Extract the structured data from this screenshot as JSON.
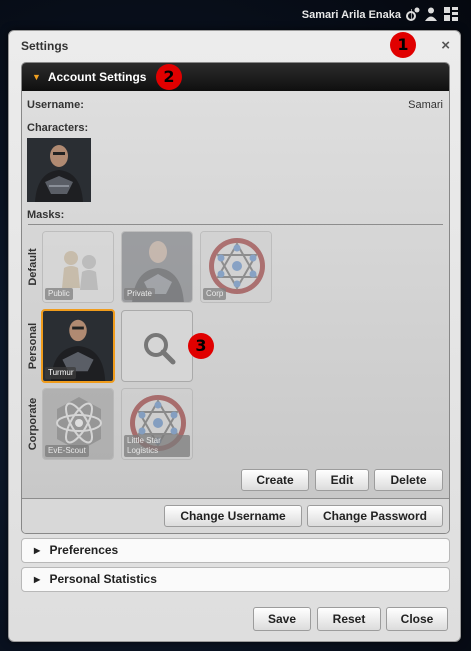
{
  "topbar": {
    "user_name": "Samari Arila Enaka",
    "separator": "|",
    "icons": [
      "settings-icon",
      "user-icon",
      "grid-icon"
    ]
  },
  "window": {
    "title": "Settings",
    "close_label": "×"
  },
  "callouts": [
    "1",
    "2",
    "3"
  ],
  "account_settings": {
    "header": "Account Settings",
    "username_label": "Username:",
    "username_value": "Samari",
    "characters_label": "Characters:",
    "masks_label": "Masks:",
    "groups": {
      "default": {
        "label": "Default",
        "masks": [
          "Public",
          "Private",
          "Corp"
        ]
      },
      "personal": {
        "label": "Personal",
        "masks": [
          "Turmur"
        ],
        "search_icon": "search-icon"
      },
      "corporate": {
        "label": "Corporate",
        "masks": [
          "EvE-Scout",
          "Little Star Logistics"
        ]
      }
    },
    "buttons": {
      "create": "Create",
      "edit": "Edit",
      "delete": "Delete",
      "change_username": "Change Username",
      "change_password": "Change Password"
    }
  },
  "sections": {
    "preferences": "Preferences",
    "personal_statistics": "Personal Statistics"
  },
  "footer": {
    "save": "Save",
    "reset": "Reset",
    "close": "Close"
  },
  "colors": {
    "accent_orange": "#f09c1c",
    "header_dark": "#1a1a1a",
    "callout_red": "#e00000"
  }
}
